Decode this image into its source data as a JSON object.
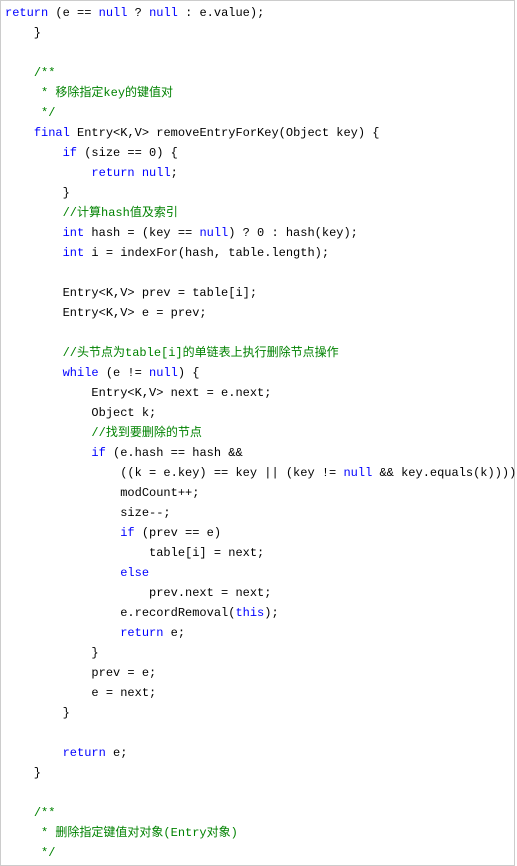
{
  "code": {
    "lines": [
      {
        "indent": 0,
        "segments": [
          {
            "t": "return",
            "c": "kw"
          },
          {
            "t": " (e == "
          },
          {
            "t": "null",
            "c": "kw"
          },
          {
            "t": " ? "
          },
          {
            "t": "null",
            "c": "kw"
          },
          {
            "t": " : e.value);"
          }
        ]
      },
      {
        "indent": 1,
        "segments": [
          {
            "t": "}"
          }
        ]
      },
      {
        "indent": 0,
        "segments": [
          {
            "t": ""
          }
        ]
      },
      {
        "indent": 1,
        "segments": [
          {
            "t": "/**",
            "c": "com"
          }
        ]
      },
      {
        "indent": 1,
        "segments": [
          {
            "t": " * 移除指定key的键值对",
            "c": "com"
          }
        ]
      },
      {
        "indent": 1,
        "segments": [
          {
            "t": " */",
            "c": "com"
          }
        ]
      },
      {
        "indent": 1,
        "segments": [
          {
            "t": "final",
            "c": "kw"
          },
          {
            "t": " Entry<K,V> removeEntryForKey(Object key) {"
          }
        ]
      },
      {
        "indent": 2,
        "segments": [
          {
            "t": "if",
            "c": "kw"
          },
          {
            "t": " (size == 0) {"
          }
        ]
      },
      {
        "indent": 3,
        "segments": [
          {
            "t": "return",
            "c": "kw"
          },
          {
            "t": " "
          },
          {
            "t": "null",
            "c": "kw"
          },
          {
            "t": ";"
          }
        ]
      },
      {
        "indent": 2,
        "segments": [
          {
            "t": "}"
          }
        ]
      },
      {
        "indent": 2,
        "segments": [
          {
            "t": "//计算hash值及索引",
            "c": "com"
          }
        ]
      },
      {
        "indent": 2,
        "segments": [
          {
            "t": "int",
            "c": "kw"
          },
          {
            "t": " hash = (key == "
          },
          {
            "t": "null",
            "c": "kw"
          },
          {
            "t": ") ? 0 : hash(key);"
          }
        ]
      },
      {
        "indent": 2,
        "segments": [
          {
            "t": "int",
            "c": "kw"
          },
          {
            "t": " i = indexFor(hash, table.length);"
          }
        ]
      },
      {
        "indent": 0,
        "segments": [
          {
            "t": ""
          }
        ]
      },
      {
        "indent": 2,
        "segments": [
          {
            "t": "Entry<K,V> prev = table[i];"
          }
        ]
      },
      {
        "indent": 2,
        "segments": [
          {
            "t": "Entry<K,V> e = prev;"
          }
        ]
      },
      {
        "indent": 0,
        "segments": [
          {
            "t": ""
          }
        ]
      },
      {
        "indent": 2,
        "segments": [
          {
            "t": "//头节点为table[i]的单链表上执行删除节点操作",
            "c": "com"
          }
        ]
      },
      {
        "indent": 2,
        "segments": [
          {
            "t": "while",
            "c": "kw"
          },
          {
            "t": " (e != "
          },
          {
            "t": "null",
            "c": "kw"
          },
          {
            "t": ") {"
          }
        ]
      },
      {
        "indent": 3,
        "segments": [
          {
            "t": "Entry<K,V> next = e.next;"
          }
        ]
      },
      {
        "indent": 3,
        "segments": [
          {
            "t": "Object k;"
          }
        ]
      },
      {
        "indent": 3,
        "segments": [
          {
            "t": "//找到要删除的节点",
            "c": "com"
          }
        ]
      },
      {
        "indent": 3,
        "segments": [
          {
            "t": "if",
            "c": "kw"
          },
          {
            "t": " (e.hash == hash &&"
          }
        ]
      },
      {
        "indent": 4,
        "segments": [
          {
            "t": "((k = e.key) == key || (key != "
          },
          {
            "t": "null",
            "c": "kw"
          },
          {
            "t": " && key.equals(k)))) {"
          }
        ]
      },
      {
        "indent": 4,
        "segments": [
          {
            "t": "modCount++;"
          }
        ]
      },
      {
        "indent": 4,
        "segments": [
          {
            "t": "size--;"
          }
        ]
      },
      {
        "indent": 4,
        "segments": [
          {
            "t": "if",
            "c": "kw"
          },
          {
            "t": " (prev == e)"
          }
        ]
      },
      {
        "indent": 5,
        "segments": [
          {
            "t": "table[i] = next;"
          }
        ]
      },
      {
        "indent": 4,
        "segments": [
          {
            "t": "else",
            "c": "kw"
          }
        ]
      },
      {
        "indent": 5,
        "segments": [
          {
            "t": "prev.next = next;"
          }
        ]
      },
      {
        "indent": 4,
        "segments": [
          {
            "t": "e.recordRemoval("
          },
          {
            "t": "this",
            "c": "kw"
          },
          {
            "t": ");"
          }
        ]
      },
      {
        "indent": 4,
        "segments": [
          {
            "t": "return",
            "c": "kw"
          },
          {
            "t": " e;"
          }
        ]
      },
      {
        "indent": 3,
        "segments": [
          {
            "t": "}"
          }
        ]
      },
      {
        "indent": 3,
        "segments": [
          {
            "t": "prev = e;"
          }
        ]
      },
      {
        "indent": 3,
        "segments": [
          {
            "t": "e = next;"
          }
        ]
      },
      {
        "indent": 2,
        "segments": [
          {
            "t": "}"
          }
        ]
      },
      {
        "indent": 0,
        "segments": [
          {
            "t": ""
          }
        ]
      },
      {
        "indent": 2,
        "segments": [
          {
            "t": "return",
            "c": "kw"
          },
          {
            "t": " e;"
          }
        ]
      },
      {
        "indent": 1,
        "segments": [
          {
            "t": "}"
          }
        ]
      },
      {
        "indent": 0,
        "segments": [
          {
            "t": ""
          }
        ]
      },
      {
        "indent": 1,
        "segments": [
          {
            "t": "/**",
            "c": "com"
          }
        ]
      },
      {
        "indent": 1,
        "segments": [
          {
            "t": " * 删除指定键值对对象(Entry对象)",
            "c": "com"
          }
        ]
      },
      {
        "indent": 1,
        "segments": [
          {
            "t": " */",
            "c": "com"
          }
        ]
      }
    ]
  }
}
